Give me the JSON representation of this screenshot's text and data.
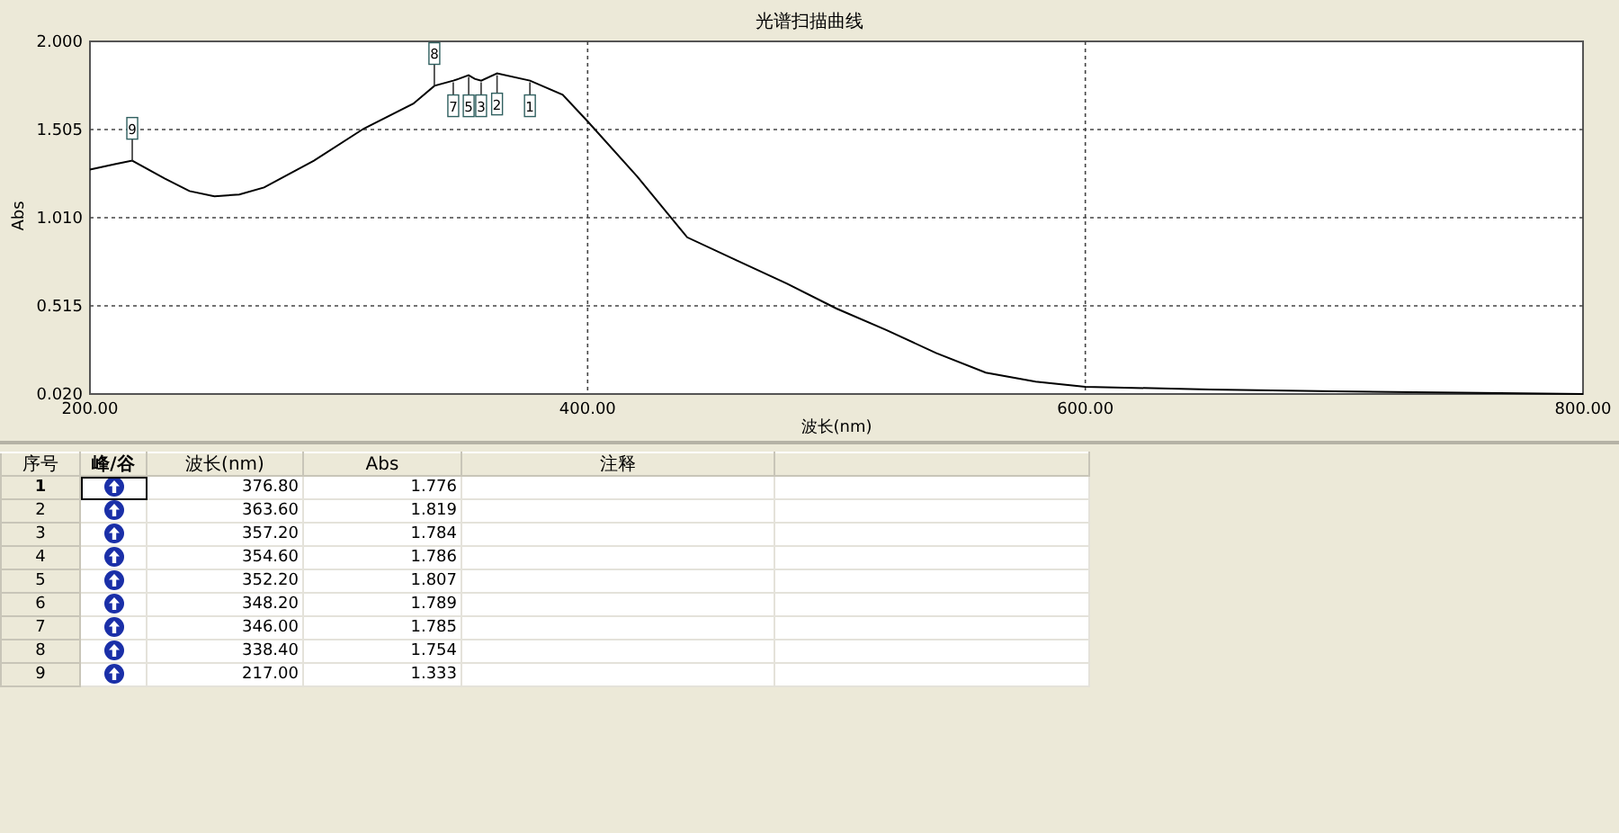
{
  "chart": {
    "chart_data": {
      "type": "line",
      "title": "光谱扫描曲线",
      "xlabel": "波长(nm)",
      "ylabel": "Abs",
      "x": [
        200,
        210,
        217,
        230,
        240,
        250,
        260,
        270,
        290,
        310,
        330,
        338.4,
        346,
        348.2,
        352.2,
        354.6,
        357.2,
        363.6,
        376.8,
        390,
        400,
        420,
        440,
        460,
        480,
        500,
        520,
        540,
        560,
        580,
        600,
        650,
        700,
        750,
        800
      ],
      "grid": true,
      "series": [
        {
          "color": "#000000",
          "values": [
            1.28,
            1.31,
            1.33,
            1.23,
            1.16,
            1.13,
            1.14,
            1.18,
            1.33,
            1.51,
            1.65,
            1.75,
            1.78,
            1.79,
            1.81,
            1.79,
            1.78,
            1.82,
            1.78,
            1.7,
            1.55,
            1.24,
            0.9,
            0.77,
            0.64,
            0.5,
            0.38,
            0.25,
            0.14,
            0.09,
            0.06,
            0.045,
            0.035,
            0.028,
            0.02
          ]
        }
      ],
      "xlim": [
        200,
        800
      ],
      "ylim": [
        0.02,
        2.0
      ],
      "xticks": [
        {
          "value": 200,
          "label": "200.00"
        },
        {
          "value": 400,
          "label": "400.00"
        },
        {
          "value": 600,
          "label": "600.00"
        },
        {
          "value": 800,
          "label": "800.00"
        }
      ],
      "yticks": [
        {
          "value": 0.02,
          "label": "0.020"
        },
        {
          "value": 0.515,
          "label": "0.515"
        },
        {
          "value": 1.01,
          "label": "1.010"
        },
        {
          "value": 1.505,
          "label": "1.505"
        },
        {
          "value": 2.0,
          "label": "2.000"
        }
      ],
      "annotations": [
        {
          "x": 376.8,
          "y": 1.78,
          "text": "1"
        },
        {
          "x": 363.6,
          "y": 1.82,
          "text": "2"
        },
        {
          "x": 357.2,
          "y": 1.78,
          "text": "3"
        },
        {
          "x": 352.2,
          "y": 1.81,
          "text": "5"
        },
        {
          "x": 346.0,
          "y": 1.78,
          "text": "7"
        },
        {
          "x": 338.4,
          "y": 1.75,
          "text": "8"
        },
        {
          "x": 217.0,
          "y": 1.33,
          "text": "9"
        }
      ]
    }
  },
  "table": {
    "columns": [
      "序号",
      "峰/谷",
      "波长(nm)",
      "Abs",
      "注释"
    ],
    "rows": [
      {
        "no": "1",
        "kind": "peak",
        "wavelength": "376.80",
        "abs": "1.776",
        "selected": true
      },
      {
        "no": "2",
        "kind": "peak",
        "wavelength": "363.60",
        "abs": "1.819",
        "selected": false
      },
      {
        "no": "3",
        "kind": "peak",
        "wavelength": "357.20",
        "abs": "1.784",
        "selected": false
      },
      {
        "no": "4",
        "kind": "peak",
        "wavelength": "354.60",
        "abs": "1.786",
        "selected": false
      },
      {
        "no": "5",
        "kind": "peak",
        "wavelength": "352.20",
        "abs": "1.807",
        "selected": false
      },
      {
        "no": "6",
        "kind": "peak",
        "wavelength": "348.20",
        "abs": "1.789",
        "selected": false
      },
      {
        "no": "7",
        "kind": "peak",
        "wavelength": "346.00",
        "abs": "1.785",
        "selected": false
      },
      {
        "no": "8",
        "kind": "peak",
        "wavelength": "338.40",
        "abs": "1.754",
        "selected": false
      },
      {
        "no": "9",
        "kind": "peak",
        "wavelength": "217.00",
        "abs": "1.333",
        "selected": false
      }
    ]
  }
}
